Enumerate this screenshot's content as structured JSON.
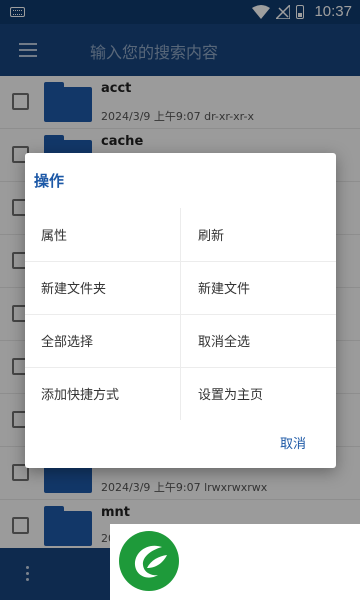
{
  "status_bar": {
    "time": "10:37"
  },
  "app_bar": {
    "search_placeholder": "输入您的搜索内容"
  },
  "files": [
    {
      "name": "acct",
      "meta": "2024/3/9 上午9:07  dr-xr-xr-x"
    },
    {
      "name": "cache",
      "meta": ""
    },
    {
      "name": "",
      "meta": ""
    },
    {
      "name": "",
      "meta": ""
    },
    {
      "name": "",
      "meta": ""
    },
    {
      "name": "",
      "meta": ""
    },
    {
      "name": "",
      "meta": ""
    },
    {
      "name": "",
      "meta": "2024/3/9 上午9:07  lrwxrwxrwx"
    },
    {
      "name": "mnt",
      "meta": "2024"
    }
  ],
  "dialog": {
    "title": "操作",
    "options": [
      [
        "属性",
        "刷新"
      ],
      [
        "新建文件夹",
        "新建文件"
      ],
      [
        "全部选择",
        "取消全选"
      ],
      [
        "添加快捷方式",
        "设置为主页"
      ]
    ],
    "cancel": "取消"
  },
  "colors": {
    "primary": "#17447f",
    "status_bar": "#0f3a6e",
    "accent": "#1c58a6",
    "folder": "#1e5aa8",
    "logo_green": "#1e9a3a"
  }
}
